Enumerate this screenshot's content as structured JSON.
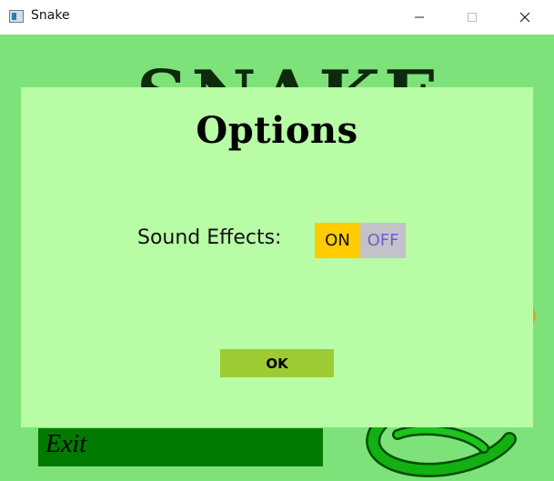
{
  "window": {
    "title": "Snake",
    "icons": {
      "app": "app-window-icon",
      "minimize": "minimize-icon",
      "maximize": "maximize-icon",
      "close": "close-icon"
    }
  },
  "background": {
    "title_fragment": "SNAKE",
    "exit_label": "Exit",
    "canvas_color": "#7ee27a",
    "exit_bar_color": "#007a00"
  },
  "dialog": {
    "title": "Options",
    "sound_effects_label": "Sound Effects:",
    "toggle": {
      "on_label": "ON",
      "off_label": "OFF",
      "selected": "ON",
      "on_color": "#ffcc00",
      "off_color": "#c4c2c8"
    },
    "ok_label": "OK",
    "background_color": "#b8fda6"
  }
}
